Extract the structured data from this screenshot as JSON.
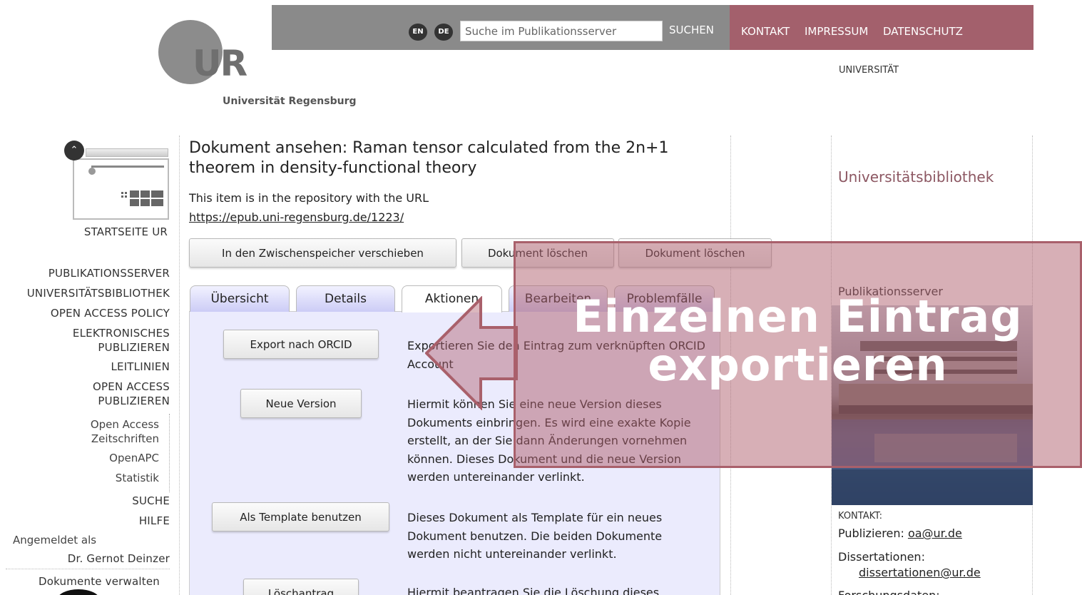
{
  "header": {
    "logo_letters": "UR",
    "logo_caption": "Universität Regensburg",
    "lang_en": "EN",
    "lang_de": "DE",
    "search_placeholder": "Suche im Publikationsserver",
    "search_button": "SUCHEN",
    "links": [
      "KONTAKT",
      "IMPRESSUM",
      "DATENSCHUTZ"
    ],
    "universitaet_label": "UNIVERSITÄT",
    "colors": {
      "grey_bar": "#8a8a8a",
      "accent": "#a3606c"
    }
  },
  "sidebar": {
    "startseite": "STARTSEITE UR",
    "items": [
      "PUBLIKATIONSSERVER",
      "UNIVERSITÄTSBIBLIOTHEK",
      "OPEN ACCESS POLICY",
      "ELEKTRONISCHES PUBLIZIEREN",
      "LEITLINIEN",
      "OPEN ACCESS PUBLIZIEREN"
    ],
    "subitems": [
      "Open Access Zeitschriften",
      "OpenAPC",
      "Statistik"
    ],
    "suche": "SUCHE",
    "hilfe": "HILFE",
    "logged_in_label": "Angemeldet als",
    "user_name": "Dr. Gernot Deinzer",
    "manage_docs": "Dokumente verwalten"
  },
  "main": {
    "title": "Dokument ansehen: Raman tensor calculated from the 2n+1 theorem in density-functional theory",
    "repo_text": "This item is in the repository with the URL",
    "repo_url": "https://epub.uni-regensburg.de/1223/",
    "buttons": [
      "In den Zwischenspeicher verschieben",
      "Dokument löschen",
      "Dokument löschen"
    ],
    "tabs": [
      "Übersicht",
      "Details",
      "Aktionen",
      "Bearbeiten",
      "Problemfälle"
    ],
    "active_tab": "Aktionen",
    "actions": [
      {
        "button": "Export nach ORCID",
        "description": "Exportieren Sie den Eintrag zum verknüpften ORCID Account"
      },
      {
        "button": "Neue Version",
        "description": "Hiermit können Sie eine neue Version dieses Dokuments einbringen. Es wird eine exakte Kopie erstellt, an der Sie dann Änderungen vornehmen können. Dieses Dokument und die neue Version werden untereinander verlinkt."
      },
      {
        "button": "Als Template benutzen",
        "description": "Dieses Dokument als Template für ein neues Dokument benutzen. Die beiden Dokumente werden nicht untereinander verlinkt."
      },
      {
        "button": "Löschantrag",
        "description": "Hiermit beantragen Sie die Löschung dieses"
      }
    ]
  },
  "right": {
    "ub_title": "Universitätsbibliothek",
    "ps_title": "Publikationsserver",
    "kontakt_label": "KONTAKT:",
    "publizieren_label": "Publizieren:",
    "publizieren_email": "oa@ur.de",
    "diss_label": "Dissertationen:",
    "diss_email": "dissertationen@ur.de",
    "forschung_label": "Forschungsdaten:"
  },
  "overlay": {
    "line1": "Einzelnen Eintrag",
    "line2": "exportieren"
  }
}
